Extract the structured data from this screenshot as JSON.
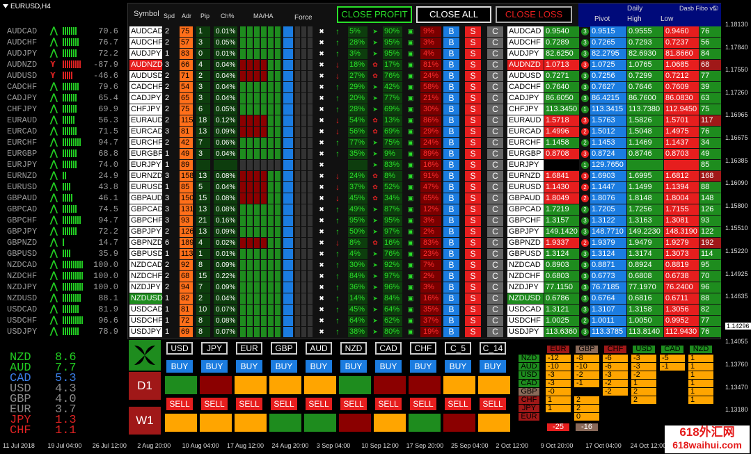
{
  "chart": {
    "name": "EURUSD,H4"
  },
  "left_list": [
    {
      "sym": "AUDCAD",
      "dir": "up",
      "val": "70.6"
    },
    {
      "sym": "AUDCHF",
      "dir": "up",
      "val": "76.7"
    },
    {
      "sym": "AUDJPY",
      "dir": "up",
      "val": "72.2"
    },
    {
      "sym": "AUDNZD",
      "dir": "dn",
      "val": "-87.9"
    },
    {
      "sym": "AUDUSD",
      "dir": "dn",
      "val": "-46.6"
    },
    {
      "sym": "CADCHF",
      "dir": "up",
      "val": "79.6"
    },
    {
      "sym": "CADJPY",
      "dir": "up",
      "val": "65.4"
    },
    {
      "sym": "CHFJPY",
      "dir": "up",
      "val": "69.9"
    },
    {
      "sym": "EURAUD",
      "dir": "up",
      "val": "56.3"
    },
    {
      "sym": "EURCAD",
      "dir": "up",
      "val": "71.5"
    },
    {
      "sym": "EURCHF",
      "dir": "up",
      "val": "94.7"
    },
    {
      "sym": "EURGBP",
      "dir": "up",
      "val": "68.8"
    },
    {
      "sym": "EURJPY",
      "dir": "up",
      "val": "74.0"
    },
    {
      "sym": "EURNZD",
      "dir": "up",
      "val": "24.9"
    },
    {
      "sym": "EURUSD",
      "dir": "up",
      "val": "43.8"
    },
    {
      "sym": "GBPAUD",
      "dir": "up",
      "val": "46.1"
    },
    {
      "sym": "GBPCAD",
      "dir": "up",
      "val": "74.5"
    },
    {
      "sym": "GBPCHF",
      "dir": "up",
      "val": "94.7"
    },
    {
      "sym": "GBPJPY",
      "dir": "up",
      "val": "72.2"
    },
    {
      "sym": "GBPNZD",
      "dir": "up",
      "val": "14.7"
    },
    {
      "sym": "GBPUSD",
      "dir": "up",
      "val": "35.9"
    },
    {
      "sym": "NZDCAD",
      "dir": "up",
      "val": "100.0"
    },
    {
      "sym": "NZDCHF",
      "dir": "up",
      "val": "100.0"
    },
    {
      "sym": "NZDJPY",
      "dir": "up",
      "val": "100.0"
    },
    {
      "sym": "NZDUSD",
      "dir": "up",
      "val": "88.1"
    },
    {
      "sym": "USDCAD",
      "dir": "up",
      "val": "81.9"
    },
    {
      "sym": "USDCHF",
      "dir": "up",
      "val": "96.6"
    },
    {
      "sym": "USDJPY",
      "dir": "up",
      "val": "78.9"
    }
  ],
  "ranks": [
    {
      "cur": "NZD",
      "val": "8.6",
      "color": "#22cc22"
    },
    {
      "cur": "AUD",
      "val": "7.7",
      "color": "#22cc22"
    },
    {
      "cur": "CAD",
      "val": "5.3",
      "color": "#3a7ee6"
    },
    {
      "cur": "USD",
      "val": "4.3",
      "color": "#8a8a8a"
    },
    {
      "cur": "GBP",
      "val": "4.0",
      "color": "#8a8a8a"
    },
    {
      "cur": "EUR",
      "val": "3.7",
      "color": "#8a8a8a"
    },
    {
      "cur": "JPY",
      "val": "1.3",
      "color": "#dd2222"
    },
    {
      "cur": "CHF",
      "val": "1.1",
      "color": "#dd2222"
    }
  ],
  "header": {
    "symbol": "Symbol",
    "spd": "Spd",
    "adr": "Adr",
    "pip": "Pip",
    "ch": "Ch%",
    "maha": "MA/HA",
    "force": "Force",
    "close_profit": "CLOSE PROFIT",
    "close_all": "CLOSE ALL",
    "close_loss": "CLOSE LOSS",
    "daily": "Daily",
    "dash": "Dasb Fibo v5",
    "pivot": "Pivot",
    "high": "High",
    "low": "Low"
  },
  "rows": [
    {
      "s": "AUDCAD",
      "spd": "2",
      "adr": "75",
      "pip": "1",
      "ch": "0.01%",
      "ar": "up",
      "p1": "5%",
      "p2": "90%",
      "p3": "9%",
      "pr": "0.9540",
      "prc": "g",
      "n": "3",
      "nc": "g",
      "pv": "0.9515",
      "hi": "0.9555",
      "lo": "0.9460",
      "pts": "76",
      "ptc": "#1e8c1e"
    },
    {
      "s": "AUDCHF",
      "spd": "2",
      "adr": "57",
      "pip": "3",
      "ch": "0.05%",
      "ar": "up",
      "p1": "28%",
      "p2": "95%",
      "p3": "3%",
      "pr": "0.7289",
      "prc": "g",
      "n": "3",
      "nc": "g",
      "pv": "0.7265",
      "hi": "0.7293",
      "lo": "0.7237",
      "pts": "56",
      "ptc": "#1e8c1e"
    },
    {
      "s": "AUDJPY",
      "spd": "1",
      "adr": "83",
      "pip": "0",
      "ch": "0.01%",
      "ar": "up",
      "p1": "3%",
      "p2": "95%",
      "p3": "4%",
      "pr": "82.6250",
      "prc": "g",
      "n": "3",
      "nc": "g",
      "pv": "82.2795",
      "hi": "82.6930",
      "lo": "81.8660",
      "pts": "84",
      "ptc": "#1e8c1e"
    },
    {
      "s": "AUDNZD",
      "spd": "3",
      "adr": "66",
      "pip": "4",
      "ch": "0.04%",
      "ar": "dn",
      "p1": "18%",
      "p2": "17%",
      "p3": "81%",
      "pr": "1.0713",
      "prc": "r",
      "n": "3",
      "nc": "r",
      "pv": "1.0725",
      "hi": "1.0765",
      "lo": "1.0685",
      "pts": "68",
      "ptc": "#a01818",
      "hl": "hl"
    },
    {
      "s": "AUDUSD",
      "spd": "2",
      "adr": "71",
      "pip": "2",
      "ch": "0.04%",
      "ar": "dn",
      "p1": "27%",
      "p2": "76%",
      "p3": "24%",
      "pr": "0.7271",
      "prc": "g",
      "n": "3",
      "nc": "g",
      "pv": "0.7256",
      "hi": "0.7299",
      "lo": "0.7212",
      "pts": "77",
      "ptc": "#1e8c1e"
    },
    {
      "s": "CADCHF",
      "spd": "2",
      "adr": "54",
      "pip": "3",
      "ch": "0.04%",
      "ar": "up",
      "p1": "29%",
      "p2": "42%",
      "p3": "58%",
      "pr": "0.7640",
      "prc": "g",
      "n": "3",
      "nc": "g",
      "pv": "0.7627",
      "hi": "0.7646",
      "lo": "0.7609",
      "pts": "39",
      "ptc": "#1e8c1e"
    },
    {
      "s": "CADJPY",
      "spd": "2",
      "adr": "65",
      "pip": "3",
      "ch": "0.04%",
      "ar": "up",
      "p1": "20%",
      "p2": "77%",
      "p3": "21%",
      "pr": "86.6050",
      "prc": "g",
      "n": "3",
      "nc": "g",
      "pv": "86.4215",
      "hi": "86.7600",
      "lo": "86.0830",
      "pts": "63",
      "ptc": "#1e8c1e"
    },
    {
      "s": "CHFJPY",
      "spd": "2",
      "adr": "75",
      "pip": "6",
      "ch": "0.05%",
      "ar": "up",
      "p1": "28%",
      "p2": "69%",
      "p3": "30%",
      "pr": "113.3450",
      "prc": "g",
      "n": "1",
      "nc": "g",
      "pv": "113.3415",
      "hi": "113.7380",
      "lo": "112.9450",
      "pts": "75",
      "ptc": "#1e8c1e"
    },
    {
      "s": "EURAUD",
      "spd": "2",
      "adr": "115",
      "pip": "18",
      "ch": "0.12%",
      "ar": "dn",
      "p1": "54%",
      "p2": "13%",
      "p3": "86%",
      "pr": "1.5718",
      "prc": "r",
      "n": "3",
      "nc": "r",
      "pv": "1.5763",
      "hi": "1.5826",
      "lo": "1.5701",
      "pts": "117",
      "ptc": "#a01818"
    },
    {
      "s": "EURCAD",
      "spd": "3",
      "adr": "81",
      "pip": "13",
      "ch": "0.09%",
      "ar": "dn",
      "p1": "56%",
      "p2": "69%",
      "p3": "29%",
      "pr": "1.4996",
      "prc": "r",
      "n": "2",
      "nc": "r",
      "pv": "1.5012",
      "hi": "1.5048",
      "lo": "1.4975",
      "pts": "76",
      "ptc": "#1e8c1e"
    },
    {
      "s": "EURCHF",
      "spd": "2",
      "adr": "42",
      "pip": "7",
      "ch": "0.06%",
      "ar": "up",
      "p1": "77%",
      "p2": "75%",
      "p3": "24%",
      "pr": "1.1458",
      "prc": "g",
      "n": "2",
      "nc": "g",
      "pv": "1.1453",
      "hi": "1.1469",
      "lo": "1.1437",
      "pts": "34",
      "ptc": "#1e8c1e"
    },
    {
      "s": "EURGBP",
      "spd": "1",
      "adr": "49",
      "pip": "3",
      "ch": "0.04%",
      "ar": "up",
      "p1": "35%",
      "p2": "9%",
      "p3": "89%",
      "pr": "0.8708",
      "prc": "r",
      "n": "3",
      "nc": "r",
      "pv": "0.8724",
      "hi": "0.8746",
      "lo": "0.8703",
      "pts": "49",
      "ptc": "#1e8c1e"
    },
    {
      "s": "EURJPY",
      "spd": "1",
      "adr": "89",
      "pip": "",
      "ch": "",
      "ar": "",
      "p1": "",
      "p2": "83%",
      "p3": "16%",
      "pr": "",
      "prc": "n",
      "n": "1",
      "nc": "g",
      "pv": "129.7650",
      "hi": "",
      "lo": "",
      "pts": "85",
      "ptc": "#1e8c1e"
    },
    {
      "s": "EURNZD",
      "spd": "3",
      "adr": "158",
      "pip": "13",
      "ch": "0.08%",
      "ar": "dn",
      "p1": "24%",
      "p2": "8%",
      "p3": "91%",
      "pr": "1.6841",
      "prc": "r",
      "n": "3",
      "nc": "r",
      "pv": "1.6903",
      "hi": "1.6995",
      "lo": "1.6812",
      "pts": "168",
      "ptc": "#a01818"
    },
    {
      "s": "EURUSD",
      "spd": "1",
      "adr": "85",
      "pip": "5",
      "ch": "0.04%",
      "ar": "dn",
      "p1": "37%",
      "p2": "52%",
      "p3": "47%",
      "pr": "1.1430",
      "prc": "r",
      "n": "2",
      "nc": "r",
      "pv": "1.1447",
      "hi": "1.1499",
      "lo": "1.1394",
      "pts": "88",
      "ptc": "#1e8c1e"
    },
    {
      "s": "GBPAUD",
      "spd": "3",
      "adr": "150",
      "pip": "15",
      "ch": "0.08%",
      "ar": "dn",
      "p1": "45%",
      "p2": "34%",
      "p3": "65%",
      "pr": "1.8049",
      "prc": "r",
      "n": "2",
      "nc": "r",
      "pv": "1.8076",
      "hi": "1.8148",
      "lo": "1.8004",
      "pts": "148",
      "ptc": "#1e8c1e"
    },
    {
      "s": "GBPCAD",
      "spd": "3",
      "adr": "131",
      "pip": "13",
      "ch": "0.08%",
      "ar": "up",
      "p1": "49%",
      "p2": "87%",
      "p3": "12%",
      "pr": "1.7219",
      "prc": "g",
      "n": "2",
      "nc": "g",
      "pv": "1.7205",
      "hi": "1.7256",
      "lo": "1.7155",
      "pts": "126",
      "ptc": "#1e8c1e"
    },
    {
      "s": "GBPCHF",
      "spd": "3",
      "adr": "93",
      "pip": "21",
      "ch": "0.16%",
      "ar": "up",
      "p1": "95%",
      "p2": "95%",
      "p3": "3%",
      "pr": "1.3157",
      "prc": "g",
      "n": "3",
      "nc": "g",
      "pv": "1.3122",
      "hi": "1.3163",
      "lo": "1.3081",
      "pts": "93",
      "ptc": "#1e8c1e"
    },
    {
      "s": "GBPJPY",
      "spd": "2",
      "adr": "126",
      "pip": "13",
      "ch": "0.09%",
      "ar": "up",
      "p1": "50%",
      "p2": "97%",
      "p3": "2%",
      "pr": "149.1420",
      "prc": "g",
      "n": "3",
      "nc": "g",
      "pv": "148.7710",
      "hi": "149.2230",
      "lo": "148.3190",
      "pts": "122",
      "ptc": "#1e8c1e"
    },
    {
      "s": "GBPNZD",
      "spd": "6",
      "adr": "189",
      "pip": "4",
      "ch": "0.02%",
      "ar": "dn",
      "p1": "8%",
      "p2": "16%",
      "p3": "83%",
      "pr": "1.9337",
      "prc": "r",
      "n": "2",
      "nc": "r",
      "pv": "1.9379",
      "hi": "1.9479",
      "lo": "1.9279",
      "pts": "192",
      "ptc": "#a01818"
    },
    {
      "s": "GBPUSD",
      "spd": "1",
      "adr": "113",
      "pip": "1",
      "ch": "0.01%",
      "ar": "up",
      "p1": "4%",
      "p2": "76%",
      "p3": "23%",
      "pr": "1.3124",
      "prc": "g",
      "n": "3",
      "nc": "g",
      "pv": "1.3124",
      "hi": "1.3174",
      "lo": "1.3073",
      "pts": "114",
      "ptc": "#1e8c1e"
    },
    {
      "s": "NZDCAD",
      "spd": "2",
      "adr": "92",
      "pip": "8",
      "ch": "0.09%",
      "ar": "up",
      "p1": "30%",
      "p2": "92%",
      "p3": "7%",
      "pr": "0.8903",
      "prc": "g",
      "n": "3",
      "nc": "g",
      "pv": "0.8871",
      "hi": "0.8924",
      "lo": "0.8819",
      "pts": "95",
      "ptc": "#1e8c1e"
    },
    {
      "s": "NZDCHF",
      "spd": "2",
      "adr": "68",
      "pip": "15",
      "ch": "0.22%",
      "ar": "up",
      "p1": "84%",
      "p2": "97%",
      "p3": "2%",
      "pr": "0.6803",
      "prc": "g",
      "n": "3",
      "nc": "g",
      "pv": "0.6773",
      "hi": "0.6808",
      "lo": "0.6738",
      "pts": "70",
      "ptc": "#1e8c1e"
    },
    {
      "s": "NZDJPY",
      "spd": "2",
      "adr": "94",
      "pip": "7",
      "ch": "0.09%",
      "ar": "up",
      "p1": "36%",
      "p2": "96%",
      "p3": "3%",
      "pr": "77.1150",
      "prc": "g",
      "n": "3",
      "nc": "g",
      "pv": "76.7185",
      "hi": "77.1970",
      "lo": "76.2400",
      "pts": "96",
      "ptc": "#1e8c1e"
    },
    {
      "s": "NZDUSD",
      "spd": "1",
      "adr": "82",
      "pip": "2",
      "ch": "0.04%",
      "ar": "up",
      "p1": "14%",
      "p2": "84%",
      "p3": "16%",
      "pr": "0.6786",
      "prc": "g",
      "n": "3",
      "nc": "g",
      "pv": "0.6764",
      "hi": "0.6816",
      "lo": "0.6711",
      "pts": "88",
      "ptc": "#1e8c1e",
      "hl": "hlg"
    },
    {
      "s": "USDCAD",
      "spd": "1",
      "adr": "81",
      "pip": "10",
      "ch": "0.07%",
      "ar": "up",
      "p1": "45%",
      "p2": "64%",
      "p3": "35%",
      "pr": "1.3121",
      "prc": "g",
      "n": "3",
      "nc": "g",
      "pv": "1.3107",
      "hi": "1.3158",
      "lo": "1.3056",
      "pts": "82",
      "ptc": "#1e8c1e"
    },
    {
      "s": "USDCHF",
      "spd": "1",
      "adr": "72",
      "pip": "8",
      "ch": "0.08%",
      "ar": "up",
      "p1": "64%",
      "p2": "62%",
      "p3": "37%",
      "pr": "1.0025",
      "prc": "g",
      "n": "2",
      "nc": "g",
      "pv": "1.0011",
      "hi": "1.0050",
      "lo": "0.9952",
      "pts": "77",
      "ptc": "#1e8c1e"
    },
    {
      "s": "USDJPY",
      "spd": "1",
      "adr": "69",
      "pip": "8",
      "ch": "0.07%",
      "ar": "up",
      "p1": "38%",
      "p2": "80%",
      "p3": "19%",
      "pr": "113.6360",
      "prc": "g",
      "n": "3",
      "nc": "g",
      "pv": "113.3785",
      "hi": "113.8140",
      "lo": "112.9430",
      "pts": "76",
      "ptc": "#1e8c1e"
    }
  ],
  "buttons": {
    "buy": "B",
    "sell": "S",
    "close": "C"
  },
  "bottom": {
    "tf1": "D1",
    "tf2": "W1",
    "currencies": [
      "USD",
      "JPY",
      "EUR",
      "GBP",
      "AUD",
      "NZD",
      "CAD",
      "CHF",
      "C_5",
      "C_14"
    ],
    "buy": "BUY",
    "sell": "SELL",
    "d1_blocks": [
      "#1e8c1e",
      "#8b0000",
      "#ffa500",
      "#ffa500",
      "#ffa500",
      "#1e8c1e",
      "#8b0000",
      "#8b0000",
      "#ffa500",
      "#ffa500"
    ],
    "w1_blocks": [
      "#ffa500",
      "#ffa500",
      "#ffa500",
      "#1e8c1e",
      "#1e8c1e",
      "#8b0000",
      "#ffa500",
      "#1e8c1e",
      "#8b0000",
      "#ffa500"
    ]
  },
  "matrix": {
    "cols": [
      {
        "c": "EUR",
        "bg": "#a01818"
      },
      {
        "c": "GBP",
        "bg": "#8a6a5a"
      },
      {
        "c": "CHF",
        "bg": "#a01818"
      },
      {
        "c": "USD",
        "bg": "#1e8c1e"
      },
      {
        "c": "CAD",
        "bg": "#1e8c1e"
      },
      {
        "c": "NZD",
        "bg": "#1e8c1e"
      }
    ],
    "rows": [
      {
        "c": "NZD",
        "bg": "#1e8c1e"
      },
      {
        "c": "AUD",
        "bg": "#1e8c1e"
      },
      {
        "c": "USD",
        "bg": "#1e8c1e"
      },
      {
        "c": "CAD",
        "bg": "#1e8c1e"
      },
      {
        "c": "GBP",
        "bg": "#8a6a5a"
      },
      {
        "c": "CHF",
        "bg": "#a01818"
      },
      {
        "c": "JPY",
        "bg": "#a01818"
      },
      {
        "c": "EUR",
        "bg": "#a01818"
      }
    ],
    "cells": [
      [
        "-12",
        "-8",
        "-6",
        "-3",
        "-5",
        "1"
      ],
      [
        "-10",
        "-10",
        "-6",
        "-3",
        "-1",
        "1"
      ],
      [
        "-3",
        "-2",
        "-3",
        "-2",
        "",
        "1"
      ],
      [
        "-3",
        "-1",
        "-2",
        "1",
        "",
        "1"
      ],
      [
        "-0",
        "",
        "-2",
        "2",
        "",
        "1"
      ],
      [
        "1",
        "2",
        "",
        "2",
        "",
        "1"
      ],
      [
        "1",
        "2",
        "",
        "",
        "",
        ""
      ],
      [
        "",
        "0",
        "",
        "",
        "",
        ""
      ]
    ],
    "totals": [
      "-25",
      "-16"
    ]
  },
  "yaxis": [
    "1.18130",
    "1.17840",
    "1.17550",
    "1.17260",
    "1.16965",
    "1.16675",
    "1.16385",
    "1.16090",
    "1.15800",
    "1.15510",
    "1.15220",
    "1.14925",
    "1.14635",
    "1.14296",
    "1.14055",
    "1.13760",
    "1.13470",
    "1.13180",
    "1.12885"
  ],
  "xaxis": [
    "11 Jul 2018",
    "19 Jul 04:00",
    "26 Jul 12:00",
    "2 Aug 20:00",
    "10 Aug 04:00",
    "17 Aug 12:00",
    "24 Aug 20:00",
    "3 Sep 04:00",
    "10 Sep 12:00",
    "17 Sep 20:00",
    "25 Sep 04:00",
    "2 Oct 12:00",
    "9 Oct 20:00",
    "17 Oct 04:00",
    "24 Oct 12:00"
  ],
  "watermark": {
    "line1": "618外汇网",
    "line2": "618waihui.com"
  }
}
